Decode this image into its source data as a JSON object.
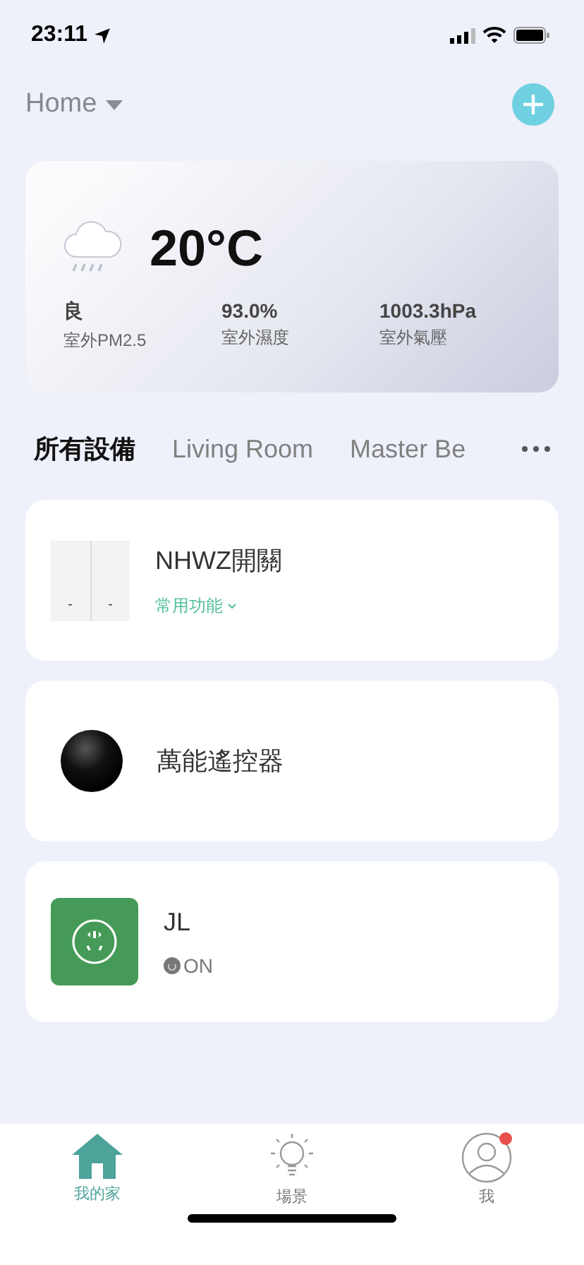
{
  "status_bar": {
    "time": "23:11"
  },
  "header": {
    "home_label": "Home"
  },
  "weather": {
    "temperature": "20°C",
    "stats": [
      {
        "value": "良",
        "label": "室外PM2.5"
      },
      {
        "value": "93.0%",
        "label": "室外濕度"
      },
      {
        "value": "1003.3hPa",
        "label": "室外氣壓"
      }
    ]
  },
  "room_tabs": [
    {
      "label": "所有設備",
      "selected": true
    },
    {
      "label": "Living Room",
      "selected": false
    },
    {
      "label": "Master Be",
      "selected": false
    }
  ],
  "devices": [
    {
      "kind": "switch",
      "name": "NHWZ開關",
      "switch_labels": [
        "-",
        "-"
      ],
      "link": "常用功能"
    },
    {
      "kind": "remote",
      "name": "萬能遙控器"
    },
    {
      "kind": "plug",
      "name": "JL",
      "status": "ON"
    }
  ],
  "tab_bar": [
    {
      "kind": "home",
      "label": "我的家",
      "selected": true
    },
    {
      "kind": "scene",
      "label": "場景",
      "selected": false
    },
    {
      "kind": "me",
      "label": "我",
      "selected": false,
      "badge": true
    }
  ]
}
